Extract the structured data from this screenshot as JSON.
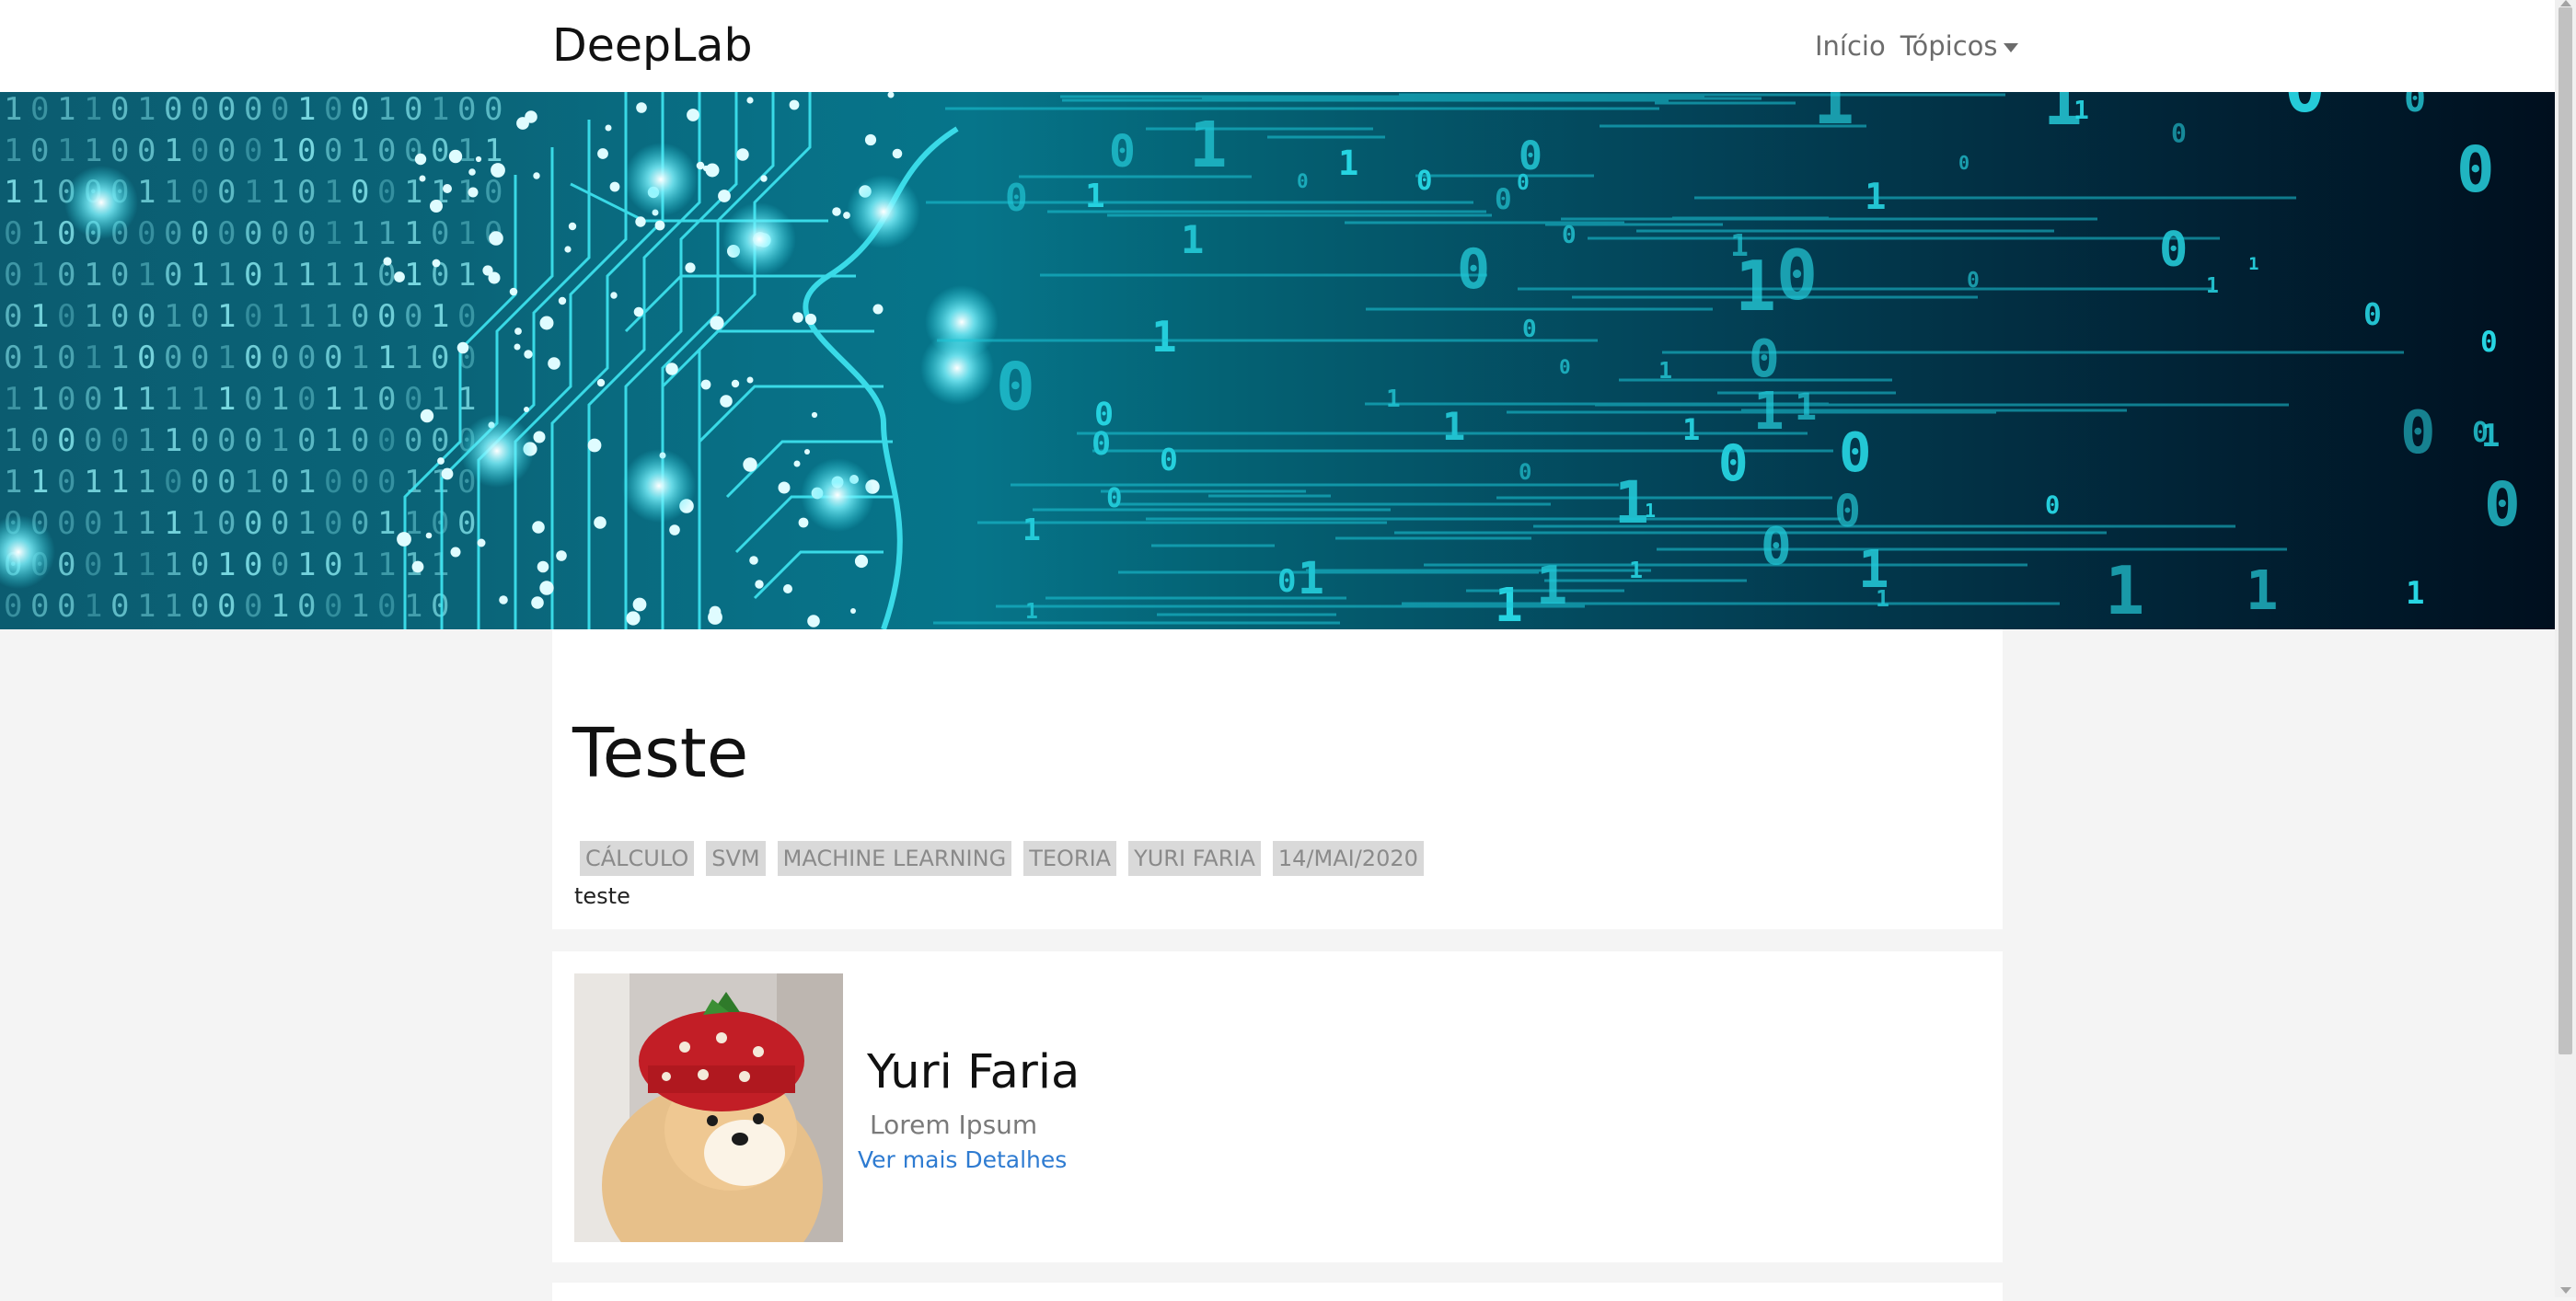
{
  "header": {
    "brand": "DeepLab",
    "nav_items": [
      {
        "label": "Início"
      },
      {
        "label": "Tópicos"
      }
    ]
  },
  "banner": {
    "image": "ai-circuit-brain-binary-code-banner",
    "colors": {
      "cyan": "#2fe3f0",
      "dark": "#001226"
    }
  },
  "post": {
    "title": "Teste",
    "tags": [
      "CÁLCULO",
      "SVM",
      "MACHINE LEARNING",
      "TEORIA",
      "YURI FARIA",
      "14/MAI/2020"
    ],
    "body": "teste"
  },
  "author": {
    "name": "Yuri Faria",
    "subtitle": "Lorem Ipsum",
    "link_label": "Ver mais Detalhes",
    "avatar": "shiba-dog-with-strawberry-hat-photo",
    "link_color": "#2e7bd1"
  }
}
